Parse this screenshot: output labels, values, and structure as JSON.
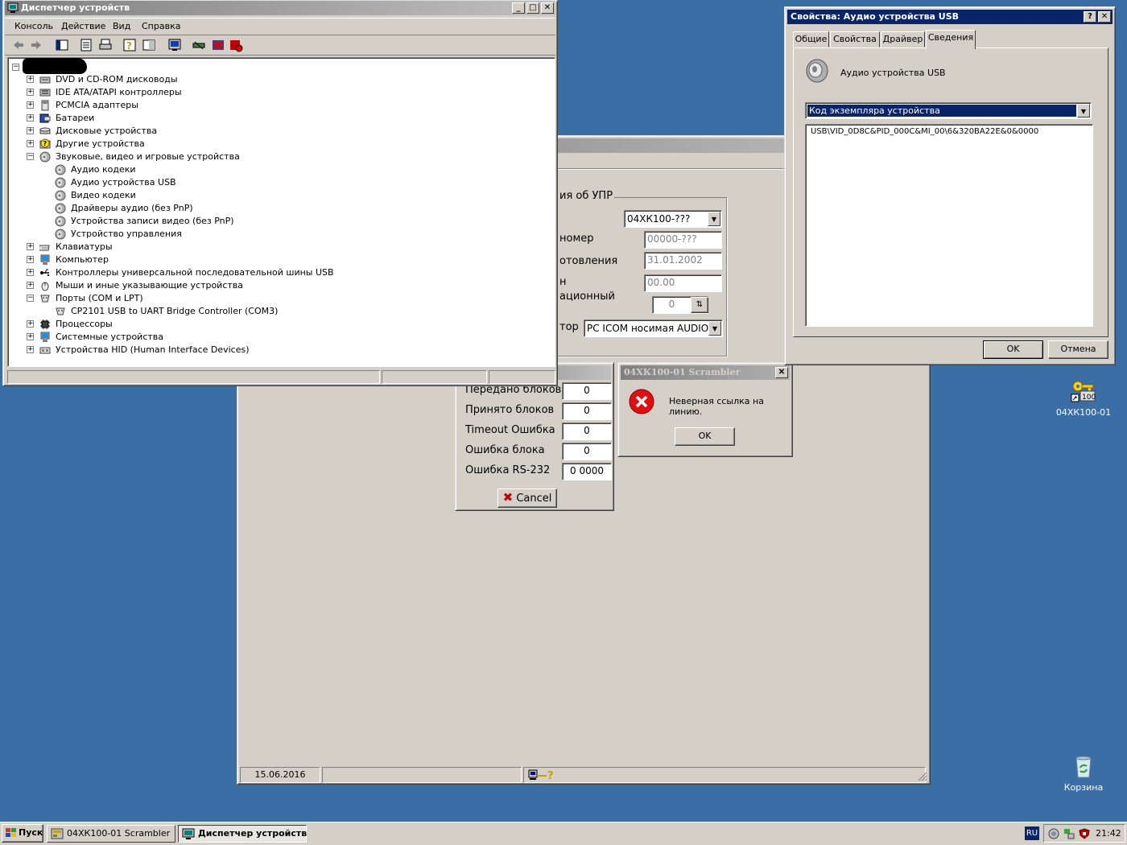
{
  "device_manager": {
    "title": "Диспетчер устройств",
    "menu": [
      "Консоль",
      "Действие",
      "Вид",
      "Справка"
    ],
    "tree": [
      {
        "label": "DVD и CD-ROM дисководы",
        "icon": "cdrom-icon",
        "level": 1,
        "expander": "+"
      },
      {
        "label": "IDE ATA/ATAPI контроллеры",
        "icon": "ide-controller-icon",
        "level": 1,
        "expander": "+"
      },
      {
        "label": "PCMCIA адаптеры",
        "icon": "pcmcia-icon",
        "level": 1,
        "expander": "+"
      },
      {
        "label": "Батареи",
        "icon": "battery-icon",
        "level": 1,
        "expander": "+"
      },
      {
        "label": "Дисковые устройства",
        "icon": "disk-drive-icon",
        "level": 1,
        "expander": "+"
      },
      {
        "label": "Другие устройства",
        "icon": "question-device-icon",
        "level": 1,
        "expander": "+"
      },
      {
        "label": "Звуковые, видео и игровые устройства",
        "icon": "speaker-icon",
        "level": 1,
        "expander": "-"
      },
      {
        "label": "Аудио кодеки",
        "icon": "speaker-icon",
        "level": 2,
        "expander": ""
      },
      {
        "label": "Аудио устройства USB",
        "icon": "speaker-icon",
        "level": 2,
        "expander": ""
      },
      {
        "label": "Видео кодеки",
        "icon": "speaker-icon",
        "level": 2,
        "expander": ""
      },
      {
        "label": "Драйверы аудио (без PnP)",
        "icon": "speaker-icon",
        "level": 2,
        "expander": ""
      },
      {
        "label": "Устройства записи видео (без PnP)",
        "icon": "speaker-icon",
        "level": 2,
        "expander": ""
      },
      {
        "label": "Устройство управления",
        "icon": "speaker-icon",
        "level": 2,
        "expander": ""
      },
      {
        "label": "Клавиатуры",
        "icon": "keyboard-icon",
        "level": 1,
        "expander": "+"
      },
      {
        "label": "Компьютер",
        "icon": "computer-icon",
        "level": 1,
        "expander": "+"
      },
      {
        "label": "Контроллеры универсальной последовательной шины USB",
        "icon": "usb-icon",
        "level": 1,
        "expander": "+"
      },
      {
        "label": "Мыши и иные указывающие устройства",
        "icon": "mouse-icon",
        "level": 1,
        "expander": "+"
      },
      {
        "label": "Порты (COM и LPT)",
        "icon": "port-icon",
        "level": 1,
        "expander": "-"
      },
      {
        "label": "CP2101 USB to UART Bridge Controller (COM3)",
        "icon": "port-icon",
        "level": 2,
        "expander": ""
      },
      {
        "label": "Процессоры",
        "icon": "processor-icon",
        "level": 1,
        "expander": "+"
      },
      {
        "label": "Системные устройства",
        "icon": "system-device-icon",
        "level": 1,
        "expander": "+"
      },
      {
        "label": "Устройства HID (Human Interface Devices)",
        "icon": "hid-icon",
        "level": 1,
        "expander": "+"
      }
    ]
  },
  "properties": {
    "title": "Свойства: Аудио устройства USB",
    "tabs": [
      "Общие",
      "Свойства",
      "Драйвер",
      "Сведения"
    ],
    "active_tab": "Сведения",
    "device_name": "Аудио устройства USB",
    "select_value": "Код экземпляра устройства",
    "value_text": "USB\\VID_0D8C&PID_000C&MI_00\\6&320BA22E&0&0000",
    "ok": "OK",
    "cancel": "Отмена"
  },
  "scrambler": {
    "group_title": "ия об УПР",
    "fields": [
      {
        "label": "",
        "value": "04ХК100-???"
      },
      {
        "label": "номер",
        "value": "00000-???"
      },
      {
        "label": "отовления",
        "value": "31.01.2002"
      },
      {
        "label": "н",
        "value": "00.00"
      },
      {
        "label": "ационный",
        "value": "0"
      },
      {
        "label": "тор",
        "value": "PC ICOM носимая AUDIO"
      }
    ],
    "status_date": "15.06.2016"
  },
  "transfer": {
    "rows": [
      {
        "label": "Передано блоков",
        "value": "0"
      },
      {
        "label": "Принято блоков",
        "value": "0"
      },
      {
        "label": "Timeout Ошибка",
        "value": "0"
      },
      {
        "label": "Ошибка блока",
        "value": "0"
      },
      {
        "label": "Ошибка RS-232",
        "value": "0 0000"
      }
    ],
    "cancel": "Cancel"
  },
  "error_dialog": {
    "title": "04ХК100-01 Scrambler",
    "message": "Неверная ссылка на линию.",
    "ok": "OK"
  },
  "desktop_icons": [
    {
      "label": "04ХК100-01",
      "icon": "key-shortcut-icon",
      "badge": "100"
    },
    {
      "label": "Корзина",
      "icon": "recycle-bin-icon"
    }
  ],
  "taskbar": {
    "start": "Пуск",
    "buttons": [
      "04ХК100-01 Scrambler",
      "Диспетчер устройств"
    ],
    "lang": "RU",
    "time": "21:42"
  },
  "colors": {
    "desktop": "#3a6ea5",
    "title_active": "#0a246a",
    "selection": "#0a246a",
    "face": "#d4d0c8"
  }
}
